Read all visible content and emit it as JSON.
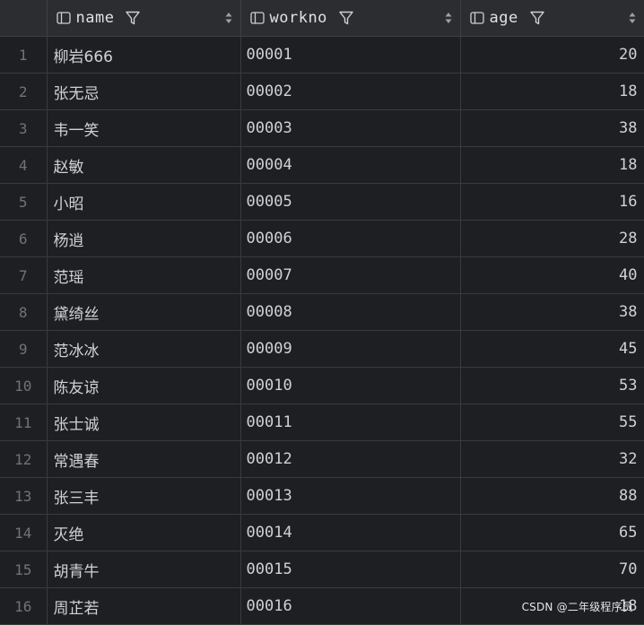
{
  "columns": [
    {
      "key": "name",
      "label": "name",
      "icon": "column-icon"
    },
    {
      "key": "workno",
      "label": "workno",
      "icon": "column-icon"
    },
    {
      "key": "age",
      "label": "age",
      "icon": "column-icon"
    }
  ],
  "rows": [
    {
      "index": "1",
      "name": "柳岩666",
      "workno": "00001",
      "age": "20"
    },
    {
      "index": "2",
      "name": "张无忌",
      "workno": "00002",
      "age": "18"
    },
    {
      "index": "3",
      "name": "韦一笑",
      "workno": "00003",
      "age": "38"
    },
    {
      "index": "4",
      "name": "赵敏",
      "workno": "00004",
      "age": "18"
    },
    {
      "index": "5",
      "name": "小昭",
      "workno": "00005",
      "age": "16"
    },
    {
      "index": "6",
      "name": "杨逍",
      "workno": "00006",
      "age": "28"
    },
    {
      "index": "7",
      "name": "范瑶",
      "workno": "00007",
      "age": "40"
    },
    {
      "index": "8",
      "name": "黛绮丝",
      "workno": "00008",
      "age": "38"
    },
    {
      "index": "9",
      "name": "范冰冰",
      "workno": "00009",
      "age": "45"
    },
    {
      "index": "10",
      "name": "陈友谅",
      "workno": "00010",
      "age": "53"
    },
    {
      "index": "11",
      "name": "张士诚",
      "workno": "00011",
      "age": "55"
    },
    {
      "index": "12",
      "name": "常遇春",
      "workno": "00012",
      "age": "32"
    },
    {
      "index": "13",
      "name": "张三丰",
      "workno": "00013",
      "age": "88"
    },
    {
      "index": "14",
      "name": "灭绝",
      "workno": "00014",
      "age": "65"
    },
    {
      "index": "15",
      "name": "胡青牛",
      "workno": "00015",
      "age": "70"
    },
    {
      "index": "16",
      "name": "周芷若",
      "workno": "00016",
      "age": "18"
    }
  ],
  "watermark": "CSDN @二年级程序员",
  "colors": {
    "background": "#1e1f22",
    "header": "#2b2d30",
    "grid_line": "#393b40",
    "text": "#cfd2d8",
    "row_index": "#6f737a"
  }
}
